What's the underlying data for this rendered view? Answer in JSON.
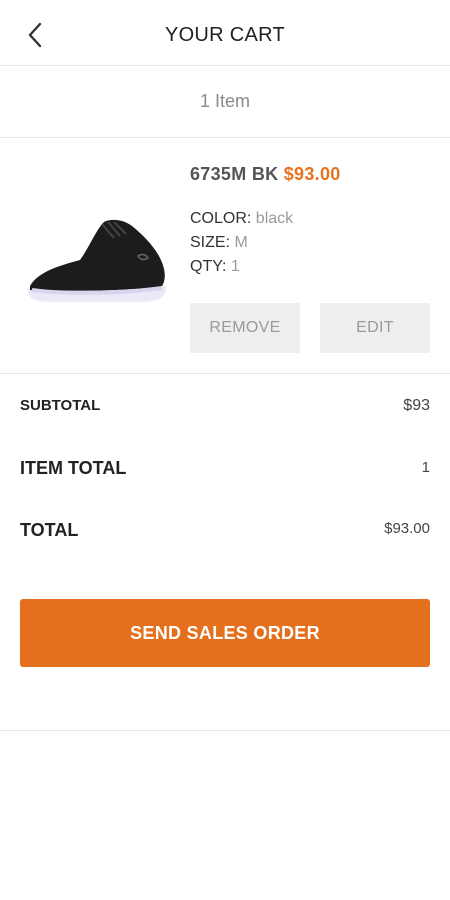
{
  "header": {
    "title": "YOUR CART",
    "back_icon": "chevron-left-icon"
  },
  "cart": {
    "count_label": "1 Item"
  },
  "item": {
    "sku": "6735M BK",
    "price": "$93.00",
    "color_label": "COLOR:",
    "color_value": "black",
    "size_label": "SIZE:",
    "size_value": "M",
    "qty_label": "QTY:",
    "qty_value": "1",
    "remove_label": "REMOVE",
    "edit_label": "EDIT"
  },
  "summary": {
    "subtotal_label": "SUBTOTAL",
    "subtotal_value": "$93",
    "item_total_label": "ITEM TOTAL",
    "item_total_value": "1",
    "total_label": "TOTAL",
    "total_value": "$93.00"
  },
  "actions": {
    "send_order_label": "SEND SALES ORDER"
  },
  "colors": {
    "accent": "#e46f1c",
    "price": "#e8731f",
    "button_gray": "#eeeeee",
    "divider": "#e6e6e6"
  }
}
